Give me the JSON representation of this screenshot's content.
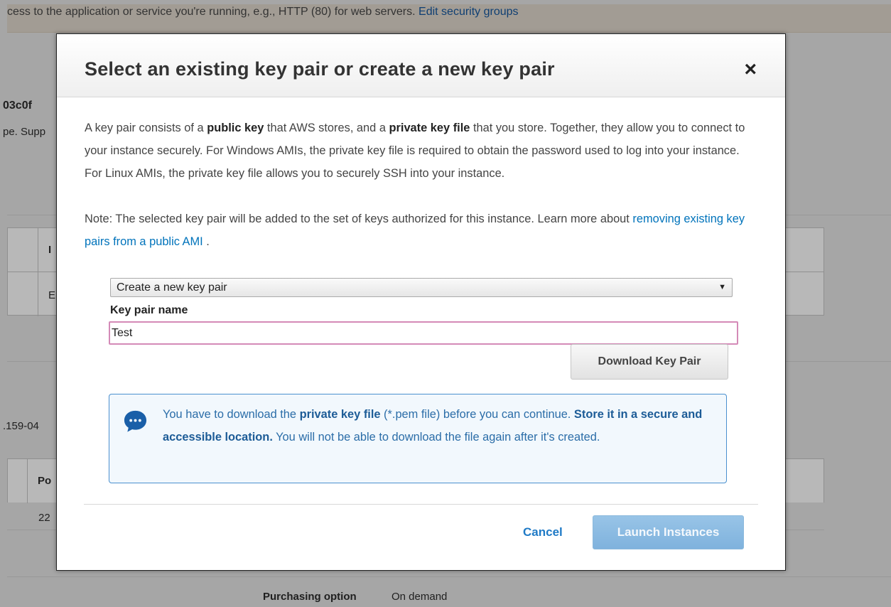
{
  "background": {
    "top_text": "cess to the application or service you're running, e.g., HTTP (80) for web servers.",
    "top_link": "Edit security groups",
    "ami_id_fragment": "03c0f",
    "ami_desc_fragment": "pe. Supp",
    "table1_header_fragment": "I",
    "table1_cell_fragment": "E",
    "ip_fragment": ".159-04",
    "table2_header_fragment": "Po",
    "table2_cell_fragment": "22",
    "purchasing_label": "Purchasing option",
    "purchasing_value": "On demand"
  },
  "modal": {
    "title": "Select an existing key pair or create a new key pair",
    "close_glyph": "×",
    "para1": {
      "t1": "A key pair consists of a ",
      "b1": "public key",
      "t2": " that AWS stores, and a ",
      "b2": "private key file",
      "t3": " that you store. Together, they allow you to connect to your instance securely. For Windows AMIs, the private key file is required to obtain the password used to log into your instance. For Linux AMIs, the private key file allows you to securely SSH into your instance."
    },
    "para2": {
      "t1": "Note: The selected key pair will be added to the set of keys authorized for this instance. Learn more about ",
      "link": "removing existing key pairs from a public AMI",
      "t2": " ."
    },
    "select": {
      "value": "Create a new key pair",
      "arrow": "▼"
    },
    "key_pair_label": "Key pair name",
    "key_pair_value": "Test",
    "download_label": "Download Key Pair",
    "info": {
      "t1": "You have to download the ",
      "b1": "private key file",
      "t2": " (*.pem file) before you can continue. ",
      "b2": "Store it in a secure and accessible location.",
      "t3": " You will not be able to download the file again after it's created.",
      "icon": "speech-bubble-icon",
      "icon_color": "#1a5fa8"
    },
    "cancel_label": "Cancel",
    "launch_label": "Launch Instances"
  }
}
